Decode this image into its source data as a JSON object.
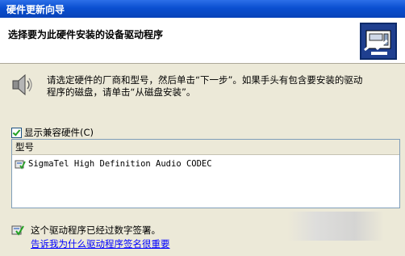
{
  "window": {
    "title": "硬件更新向导"
  },
  "header": {
    "heading": "选择要为此硬件安装的设备驱动程序"
  },
  "instruction": {
    "line1": "请选定硬件的厂商和型号，然后单击“下一步”。如果手头有包含要安装的驱动",
    "line2": "程序的磁盘，请单击“从磁盘安装”。"
  },
  "compatible_checkbox": {
    "label": "显示兼容硬件(C)",
    "checked": true
  },
  "model_list": {
    "header": "型号",
    "items": [
      "SigmaTel High Definition Audio CODEC"
    ]
  },
  "signature": {
    "status_text": "这个驱动程序已经过数字签署。",
    "link_text": "告诉我为什么驱动程序签名很重要"
  },
  "icons": {
    "header_icon": "hardware-wizard-icon",
    "speaker_icon": "speaker-icon",
    "list_item_icon": "driver-icon",
    "signature_icon": "signed-driver-icon"
  }
}
